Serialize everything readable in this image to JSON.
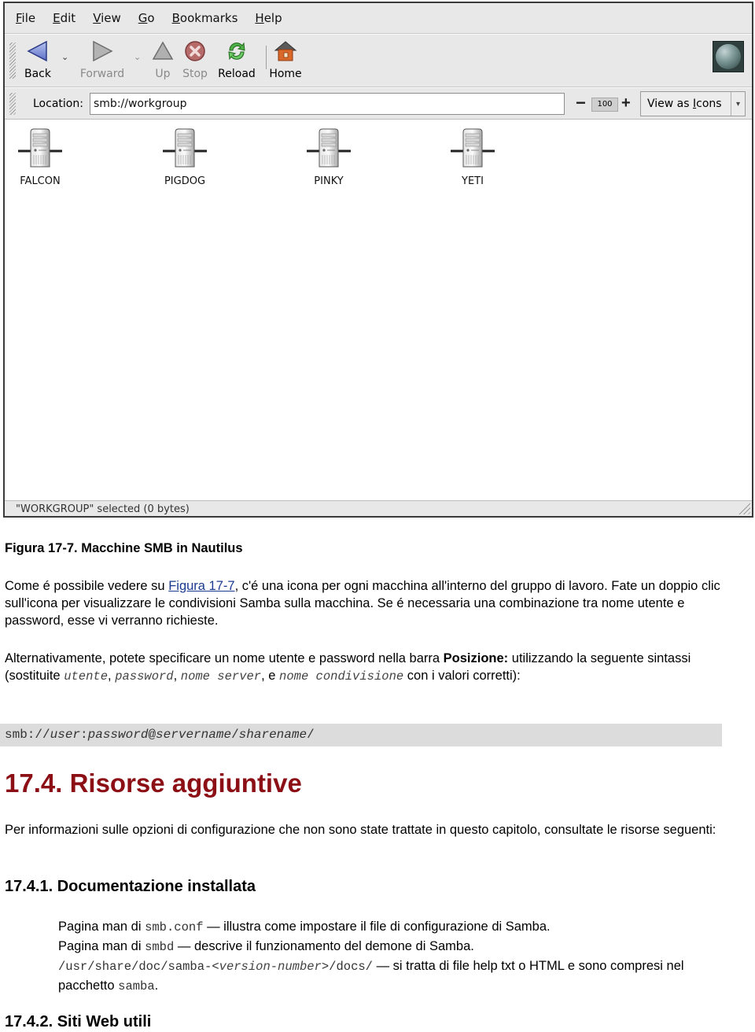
{
  "window": {
    "menu": [
      {
        "label": "File",
        "mnemonic": "F",
        "rest": "ile"
      },
      {
        "label": "Edit",
        "mnemonic": "E",
        "rest": "dit"
      },
      {
        "label": "View",
        "mnemonic": "V",
        "rest": "iew"
      },
      {
        "label": "Go",
        "mnemonic": "G",
        "rest": "o"
      },
      {
        "label": "Bookmarks",
        "mnemonic": "B",
        "rest": "ookmarks"
      },
      {
        "label": "Help",
        "mnemonic": "H",
        "rest": "elp"
      }
    ],
    "toolbar": {
      "back": "Back",
      "forward": "Forward",
      "up": "Up",
      "stop": "Stop",
      "reload": "Reload",
      "home": "Home"
    },
    "location": {
      "label": "Location:",
      "value": "smb://workgroup"
    },
    "zoom": {
      "minus": "−",
      "level": "100",
      "plus": "+"
    },
    "view_as": {
      "prefix": "View as ",
      "mnemonic": "I",
      "rest": "cons",
      "arrow": "▾"
    },
    "servers": [
      "FALCON",
      "PIGDOG",
      "PINKY",
      "YETI"
    ],
    "status": "\"WORKGROUP\" selected (0 bytes)"
  },
  "document": {
    "caption": "Figura 17-7. Macchine SMB in Nautilus",
    "p1": {
      "before": "Come é possibile vedere su ",
      "link": "Figura 17-7",
      "after": ", c'é una icona per ogni macchina all'interno del gruppo di lavoro. Fate un doppio clic sull'icona per visualizzare le condivisioni Samba sulla macchina. Se é necessaria una combinazione tra nome utente e password, esse vi verranno richieste."
    },
    "p2": {
      "t1": "Alternativamente, potete specificare un nome utente e password nella barra ",
      "bold": "Posizione:",
      "t2": " utilizzando la seguente sintassi (sostituite ",
      "v1": "utente",
      "s1": ", ",
      "v2": "password",
      "s2": ", ",
      "v3": "nome server",
      "s3": ", e ",
      "v4": "nome condivisione",
      "t3": " con i valori corretti):"
    },
    "code": {
      "prefix": "smb://",
      "user": "user",
      "colon": ":",
      "password": "password",
      "at": "@",
      "server": "servername",
      "slash": "/",
      "share": "sharename",
      "end": "/"
    },
    "h2": "17.4. Risorse aggiuntive",
    "p3": "Per informazioni sulle opzioni di configurazione che non sono state trattate in questo capitolo, consultate le risorse seguenti:",
    "h3a": "17.4.1. Documentazione installata",
    "list": [
      {
        "pre": "Pagina man di ",
        "code": "smb.conf",
        "post": " — illustra come impostare il file di configurazione di Samba."
      },
      {
        "pre": "Pagina man di ",
        "code": "smbd",
        "post": " — descrive il funzionamento del demone di Samba."
      },
      {
        "code1": "/usr/share/doc/samba-<",
        "codei": "version-number",
        "code2": ">/docs/",
        "post": " — si tratta di file help txt o HTML e sono compresi nel pacchetto ",
        "code3": "samba",
        "end": "."
      }
    ],
    "h3b": "17.4.2. Siti Web utili"
  }
}
